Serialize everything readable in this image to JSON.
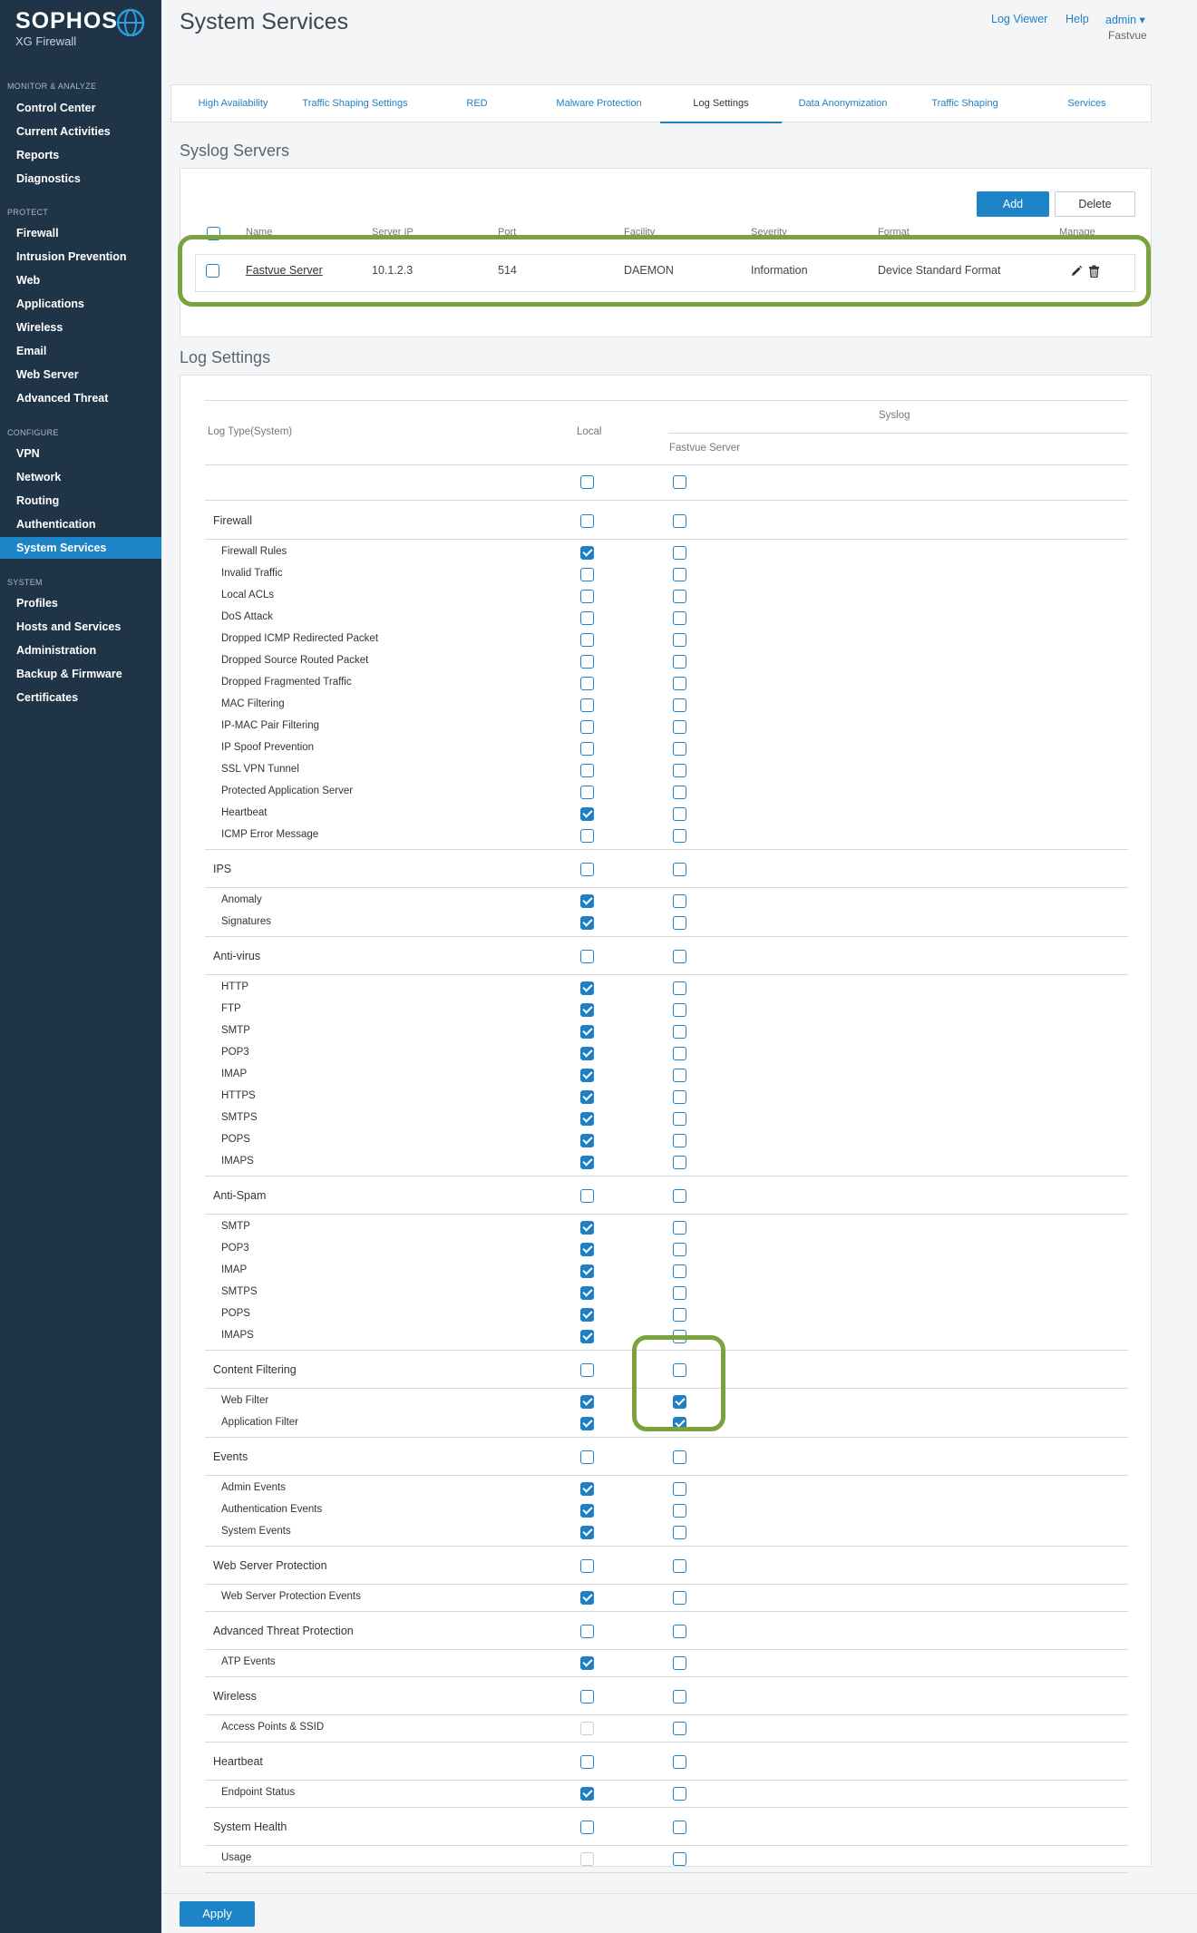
{
  "sidebar": {
    "brand": "SOPHOS",
    "product": "XG Firewall",
    "sections": [
      {
        "title": "MONITOR & ANALYZE",
        "items": [
          "Control Center",
          "Current Activities",
          "Reports",
          "Diagnostics"
        ]
      },
      {
        "title": "PROTECT",
        "items": [
          "Firewall",
          "Intrusion Prevention",
          "Web",
          "Applications",
          "Wireless",
          "Email",
          "Web Server",
          "Advanced Threat"
        ]
      },
      {
        "title": "CONFIGURE",
        "items": [
          "VPN",
          "Network",
          "Routing",
          "Authentication",
          "System Services"
        ]
      },
      {
        "title": "SYSTEM",
        "items": [
          "Profiles",
          "Hosts and Services",
          "Administration",
          "Backup & Firmware",
          "Certificates"
        ]
      }
    ],
    "active_item": "System Services"
  },
  "header": {
    "title": "System Services",
    "links": [
      "Log Viewer",
      "Help",
      "admin ▾"
    ],
    "user_sub": "Fastvue"
  },
  "tabs": [
    "High Availability",
    "Traffic Shaping Settings",
    "RED",
    "Malware Protection",
    "Log Settings",
    "Data Anonymization",
    "Traffic Shaping",
    "Services"
  ],
  "active_tab": "Log Settings",
  "syslog": {
    "title": "Syslog Servers",
    "add_label": "Add",
    "delete_label": "Delete",
    "columns": [
      "Name",
      "Server IP",
      "Port",
      "Facility",
      "Severity",
      "Format",
      "Manage"
    ],
    "servers": [
      {
        "name": "Fastvue Server",
        "ip": "10.1.2.3",
        "port": "514",
        "facility": "DAEMON",
        "severity": "Information",
        "format": "Device Standard Format"
      }
    ]
  },
  "log_settings": {
    "title": "Log Settings",
    "col_type": "Log Type(System)",
    "col_local": "Local",
    "col_syslog": "Syslog",
    "col_server": "Fastvue Server",
    "all_row": {
      "local": false,
      "syslog": false
    },
    "groups": [
      {
        "name": "Firewall",
        "local": false,
        "syslog": false,
        "items": [
          {
            "label": "Firewall Rules",
            "local": true,
            "syslog": false
          },
          {
            "label": "Invalid Traffic",
            "local": false,
            "syslog": false
          },
          {
            "label": "Local ACLs",
            "local": false,
            "syslog": false
          },
          {
            "label": "DoS Attack",
            "local": false,
            "syslog": false
          },
          {
            "label": "Dropped ICMP Redirected Packet",
            "local": false,
            "syslog": false
          },
          {
            "label": "Dropped Source Routed Packet",
            "local": false,
            "syslog": false
          },
          {
            "label": "Dropped Fragmented Traffic",
            "local": false,
            "syslog": false
          },
          {
            "label": "MAC Filtering",
            "local": false,
            "syslog": false
          },
          {
            "label": "IP-MAC Pair Filtering",
            "local": false,
            "syslog": false
          },
          {
            "label": "IP Spoof Prevention",
            "local": false,
            "syslog": false
          },
          {
            "label": "SSL VPN Tunnel",
            "local": false,
            "syslog": false
          },
          {
            "label": "Protected Application Server",
            "local": false,
            "syslog": false
          },
          {
            "label": "Heartbeat",
            "local": true,
            "syslog": false
          },
          {
            "label": "ICMP Error Message",
            "local": false,
            "syslog": false
          }
        ]
      },
      {
        "name": "IPS",
        "local": false,
        "syslog": false,
        "items": [
          {
            "label": "Anomaly",
            "local": true,
            "syslog": false
          },
          {
            "label": "Signatures",
            "local": true,
            "syslog": false
          }
        ]
      },
      {
        "name": "Anti-virus",
        "local": false,
        "syslog": false,
        "items": [
          {
            "label": "HTTP",
            "local": true,
            "syslog": false
          },
          {
            "label": "FTP",
            "local": true,
            "syslog": false
          },
          {
            "label": "SMTP",
            "local": true,
            "syslog": false
          },
          {
            "label": "POP3",
            "local": true,
            "syslog": false
          },
          {
            "label": "IMAP",
            "local": true,
            "syslog": false
          },
          {
            "label": "HTTPS",
            "local": true,
            "syslog": false
          },
          {
            "label": "SMTPS",
            "local": true,
            "syslog": false
          },
          {
            "label": "POPS",
            "local": true,
            "syslog": false
          },
          {
            "label": "IMAPS",
            "local": true,
            "syslog": false
          }
        ]
      },
      {
        "name": "Anti-Spam",
        "local": false,
        "syslog": false,
        "items": [
          {
            "label": "SMTP",
            "local": true,
            "syslog": false
          },
          {
            "label": "POP3",
            "local": true,
            "syslog": false
          },
          {
            "label": "IMAP",
            "local": true,
            "syslog": false
          },
          {
            "label": "SMTPS",
            "local": true,
            "syslog": false
          },
          {
            "label": "POPS",
            "local": true,
            "syslog": false
          },
          {
            "label": "IMAPS",
            "local": true,
            "syslog": false
          }
        ]
      },
      {
        "name": "Content Filtering",
        "local": false,
        "syslog": false,
        "items": [
          {
            "label": "Web Filter",
            "local": true,
            "syslog": true
          },
          {
            "label": "Application Filter",
            "local": true,
            "syslog": true
          }
        ]
      },
      {
        "name": "Events",
        "local": false,
        "syslog": false,
        "items": [
          {
            "label": "Admin Events",
            "local": true,
            "syslog": false
          },
          {
            "label": "Authentication Events",
            "local": true,
            "syslog": false
          },
          {
            "label": "System Events",
            "local": true,
            "syslog": false
          }
        ]
      },
      {
        "name": "Web Server Protection",
        "local": false,
        "syslog": false,
        "items": [
          {
            "label": "Web Server Protection Events",
            "local": true,
            "syslog": false
          }
        ]
      },
      {
        "name": "Advanced Threat Protection",
        "local": false,
        "syslog": false,
        "items": [
          {
            "label": "ATP Events",
            "local": true,
            "syslog": false
          }
        ]
      },
      {
        "name": "Wireless",
        "local": false,
        "syslog": false,
        "items": [
          {
            "label": "Access Points & SSID",
            "local": false,
            "local_disabled": true,
            "syslog": false
          }
        ]
      },
      {
        "name": "Heartbeat",
        "local": false,
        "syslog": false,
        "items": [
          {
            "label": "Endpoint Status",
            "local": true,
            "syslog": false
          }
        ]
      },
      {
        "name": "System Health",
        "local": false,
        "syslog": false,
        "items": [
          {
            "label": "Usage",
            "local": false,
            "local_disabled": true,
            "syslog": false
          }
        ]
      }
    ]
  },
  "footer": {
    "apply_label": "Apply"
  },
  "colors": {
    "sidebar": "#1f3447",
    "accent": "#1d84c8",
    "highlight": "#7aa23d"
  }
}
